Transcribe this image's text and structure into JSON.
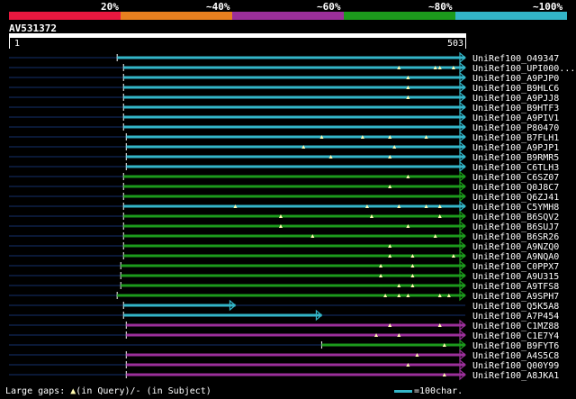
{
  "legend": {
    "labels": [
      "20%",
      "~40%",
      "~60%",
      "~80%",
      "~100%"
    ],
    "colors": [
      "#e8183f",
      "#e8801f",
      "#9b2f9a",
      "#1c9a1c",
      "#33b5c8"
    ]
  },
  "query": {
    "id": "AV531372",
    "start": "1",
    "end": "503"
  },
  "colors": {
    "cyan": "#33b5c8",
    "green": "#1c9a1c",
    "purple": "#9b2f9a",
    "dim": "#15306b",
    "gap": "#fffab0"
  },
  "footer": {
    "gaps_prefix": "Large gaps: ",
    "in_query": "(in Query)/",
    "dash": "-",
    "in_subject": " (in Subject)",
    "scale": "=100char."
  },
  "chart_data": {
    "type": "alignment",
    "query_length": 503,
    "hits": [
      {
        "id": "UniRef100_O49347",
        "color": "cyan",
        "start": 120,
        "end": 503,
        "gaps": []
      },
      {
        "id": "UniRef100_UPI000...",
        "color": "cyan",
        "start": 127,
        "end": 503,
        "gaps": [
          430,
          470,
          475,
          490
        ]
      },
      {
        "id": "UniRef100_A9PJP0",
        "color": "cyan",
        "start": 127,
        "end": 503,
        "gaps": [
          440
        ]
      },
      {
        "id": "UniRef100_B9HLC6",
        "color": "cyan",
        "start": 127,
        "end": 503,
        "gaps": [
          440
        ]
      },
      {
        "id": "UniRef100_A9PJJ8",
        "color": "cyan",
        "start": 127,
        "end": 503,
        "gaps": [
          440
        ]
      },
      {
        "id": "UniRef100_B9HTF3",
        "color": "cyan",
        "start": 127,
        "end": 503,
        "gaps": []
      },
      {
        "id": "UniRef100_A9PIV1",
        "color": "cyan",
        "start": 127,
        "end": 503,
        "gaps": []
      },
      {
        "id": "UniRef100_P80470",
        "color": "cyan",
        "start": 127,
        "end": 503,
        "gaps": []
      },
      {
        "id": "UniRef100_B7FLH1",
        "color": "cyan",
        "start": 130,
        "end": 503,
        "gaps": [
          345,
          390,
          420,
          460
        ]
      },
      {
        "id": "UniRef100_A9PJP1",
        "color": "cyan",
        "start": 130,
        "end": 503,
        "gaps": [
          325,
          425
        ]
      },
      {
        "id": "UniRef100_B9RMR5",
        "color": "cyan",
        "start": 130,
        "end": 503,
        "gaps": [
          355,
          420
        ]
      },
      {
        "id": "UniRef100_C6TLH3",
        "color": "cyan",
        "start": 130,
        "end": 503,
        "gaps": []
      },
      {
        "id": "UniRef100_C6SZ07",
        "color": "green",
        "start": 127,
        "end": 503,
        "gaps": [
          440
        ]
      },
      {
        "id": "UniRef100_Q0J8C7",
        "color": "green",
        "start": 127,
        "end": 503,
        "gaps": [
          420
        ]
      },
      {
        "id": "UniRef100_Q6ZJ41",
        "color": "green",
        "start": 127,
        "end": 503,
        "gaps": []
      },
      {
        "id": "UniRef100_C5YMH8",
        "color": "cyan",
        "start": 127,
        "end": 503,
        "gaps": [
          250,
          395,
          430,
          460,
          475
        ]
      },
      {
        "id": "UniRef100_B6SQV2",
        "color": "green",
        "start": 127,
        "end": 503,
        "gaps": [
          300,
          400,
          475
        ]
      },
      {
        "id": "UniRef100_B6SUJ7",
        "color": "green",
        "start": 127,
        "end": 503,
        "gaps": [
          300,
          440
        ]
      },
      {
        "id": "UniRef100_B6SR26",
        "color": "green",
        "start": 127,
        "end": 503,
        "gaps": [
          335,
          470
        ]
      },
      {
        "id": "UniRef100_A9NZQ0",
        "color": "green",
        "start": 127,
        "end": 503,
        "gaps": [
          420
        ]
      },
      {
        "id": "UniRef100_A9NQA0",
        "color": "green",
        "start": 127,
        "end": 503,
        "gaps": [
          420,
          445,
          490
        ]
      },
      {
        "id": "UniRef100_C0PPX7",
        "color": "green",
        "start": 124,
        "end": 503,
        "gaps": [
          410,
          445
        ]
      },
      {
        "id": "UniRef100_A9U315",
        "color": "green",
        "start": 124,
        "end": 503,
        "gaps": [
          410,
          445
        ]
      },
      {
        "id": "UniRef100_A9TFS8",
        "color": "green",
        "start": 124,
        "end": 503,
        "gaps": [
          430,
          445
        ]
      },
      {
        "id": "UniRef100_A9SPH7",
        "color": "green",
        "start": 120,
        "end": 503,
        "gaps": [
          415,
          430,
          440,
          475,
          485
        ]
      },
      {
        "id": "UniRef100_Q5K5A8",
        "color": "cyan",
        "start": 127,
        "end": 250,
        "gaps": []
      },
      {
        "id": "UniRef100_A7P454",
        "color": "cyan",
        "start": 127,
        "end": 345,
        "gaps": []
      },
      {
        "id": "UniRef100_C1MZ88",
        "color": "purple",
        "start": 130,
        "end": 503,
        "gaps": [
          420,
          475
        ]
      },
      {
        "id": "UniRef100_C1E7Y4",
        "color": "purple",
        "start": 130,
        "end": 503,
        "gaps": [
          405,
          430
        ]
      },
      {
        "id": "UniRef100_B9FYT6",
        "color": "green",
        "start": 345,
        "end": 503,
        "gaps": [
          480
        ]
      },
      {
        "id": "UniRef100_A4S5C8",
        "color": "purple",
        "start": 130,
        "end": 503,
        "gaps": [
          450
        ]
      },
      {
        "id": "UniRef100_Q00Y99",
        "color": "purple",
        "start": 130,
        "end": 503,
        "gaps": [
          440
        ]
      },
      {
        "id": "UniRef100_A8JKA1",
        "color": "purple",
        "start": 130,
        "end": 503,
        "gaps": [
          480
        ]
      }
    ]
  }
}
